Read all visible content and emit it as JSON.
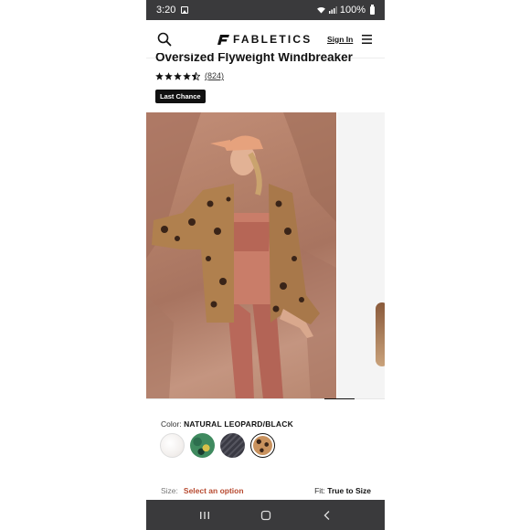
{
  "status_bar": {
    "time": "3:20",
    "battery_text": "100%",
    "icons": [
      "image-icon",
      "wifi-icon",
      "signal-icon",
      "battery-icon"
    ]
  },
  "header": {
    "logo_text": "FABLETICS",
    "sign_in_label": "Sign In",
    "icons": [
      "search-icon",
      "logo-icon",
      "menu-icon"
    ]
  },
  "product": {
    "title": "Oversized Flyweight Windbreaker",
    "rating": 4.5,
    "review_count": "(824)",
    "badge": "Last Chance"
  },
  "gallery": {
    "current_index": 1,
    "image_count": 2
  },
  "color": {
    "label": "Color:",
    "selected": "NATURAL LEOPARD/BLACK",
    "swatch_count": 4,
    "selected_index": 3
  },
  "size": {
    "label": "Size:",
    "select_text": "Select an option",
    "fit_label": "Fit:",
    "fit_value": "True to Size"
  },
  "nav_bar": {
    "icons": [
      "recents-icon",
      "home-icon",
      "back-icon"
    ]
  },
  "colors": {
    "status_bar_bg": "#3a3a3c",
    "accent_red": "#b7492f",
    "text_dark": "#111111"
  }
}
